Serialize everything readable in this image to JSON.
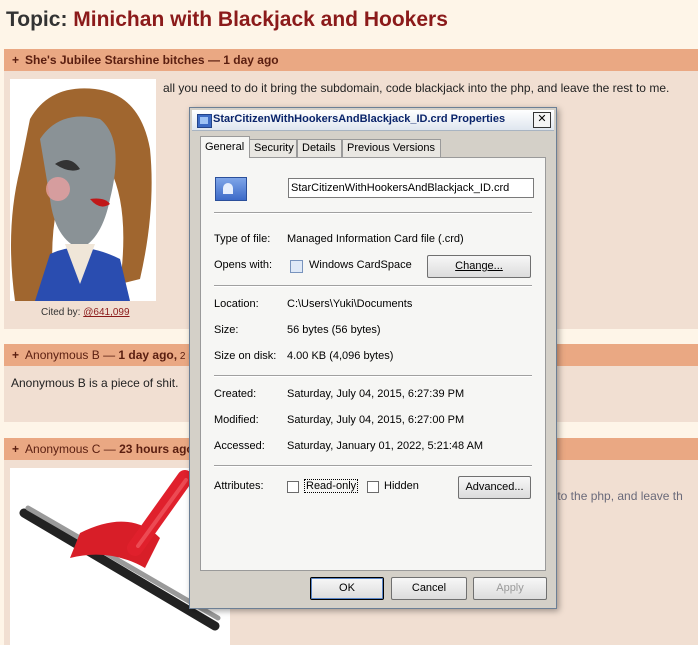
{
  "topic": {
    "prefix": "Topic: ",
    "name": "Minichan with Blackjack and Hookers"
  },
  "posts": [
    {
      "plus": "+",
      "author": "She's Jubilee Starshine bitches",
      "sep": " — ",
      "time": "1 day ago",
      "body": "all you need to do it bring the subdomain, code blackjack into the php, and leave the rest to me.",
      "cited_label": "Cited by: ",
      "cited_link": "@641,099"
    },
    {
      "plus": "+",
      "author": "Anonymous B",
      "sep": " — ",
      "time": "1 day ago,",
      "extra": " 2 r",
      "body": "Anonymous B is a piece of shit."
    },
    {
      "plus": "+",
      "author": "Anonymous C",
      "sep": " — ",
      "time": "23 hours ago",
      "body_fragment": "into the php, and leave th"
    }
  ],
  "dialog": {
    "title": "StarCitizenWithHookersAndBlackjack_ID.crd Properties",
    "close_glyph": "✕",
    "tabs": [
      "General",
      "Security",
      "Details",
      "Previous Versions"
    ],
    "filename": "StarCitizenWithHookersAndBlackjack_ID.crd",
    "fields": {
      "type_label": "Type of file:",
      "type_value": "Managed Information Card file (.crd)",
      "opens_label": "Opens with:",
      "opens_value": "Windows CardSpace",
      "change_button": "Change...",
      "location_label": "Location:",
      "location_value": "C:\\Users\\Yuki\\Documents",
      "size_label": "Size:",
      "size_value": "56 bytes (56 bytes)",
      "size_on_disk_label": "Size on disk:",
      "size_on_disk_value": "4.00 KB (4,096 bytes)",
      "created_label": "Created:",
      "created_value": "Saturday, July 04, 2015, 6:27:39 PM",
      "modified_label": "Modified:",
      "modified_value": "Saturday, July 04, 2015, 6:27:00 PM",
      "accessed_label": "Accessed:",
      "accessed_value": "Saturday, January 01, 2022, 5:21:48 AM",
      "attributes_label": "Attributes:",
      "readonly_label": "Read-only",
      "hidden_label": "Hidden",
      "advanced_button": "Advanced..."
    },
    "buttons": {
      "ok": "OK",
      "cancel": "Cancel",
      "apply": "Apply"
    }
  }
}
